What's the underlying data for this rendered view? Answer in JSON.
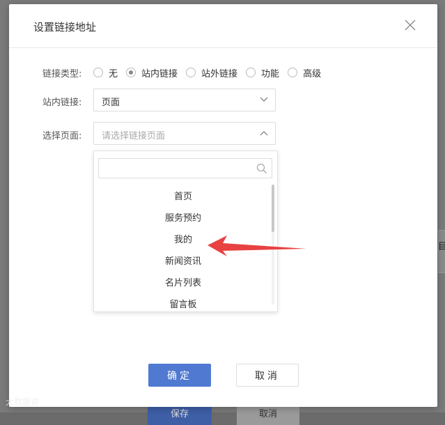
{
  "dialog": {
    "title": "设置链接地址"
  },
  "link_type": {
    "label": "链接类型:",
    "options": [
      {
        "label": "无",
        "checked": false
      },
      {
        "label": "站内链接",
        "checked": true
      },
      {
        "label": "站外链接",
        "checked": false
      },
      {
        "label": "功能",
        "checked": false
      },
      {
        "label": "高级",
        "checked": false
      }
    ]
  },
  "internal_link": {
    "label": "站内链接:",
    "value": "页面"
  },
  "page_select": {
    "label": "选择页面:",
    "placeholder": "请选择链接页面",
    "search_value": "",
    "options": [
      "首页",
      "服务预约",
      "我的",
      "新闻资讯",
      "名片列表",
      "留言板"
    ]
  },
  "buttons": {
    "ok": "确定",
    "cancel": "取消"
  },
  "background": {
    "side_text": "目",
    "save": "保存",
    "cancel": "取消"
  },
  "watermark": "大数据说"
}
